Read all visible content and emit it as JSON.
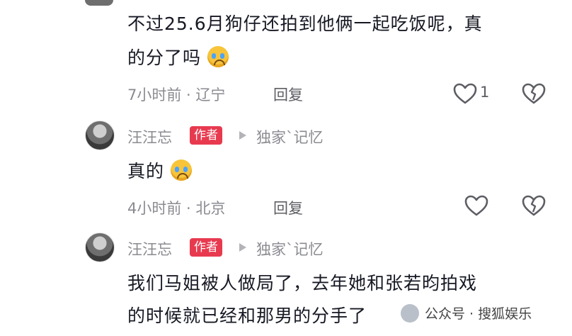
{
  "comments": [
    {
      "text_line1": "不过25.6月狗仔还拍到他俩一起吃饭呢，真",
      "text_line2": "的分了吗",
      "emoji": "crying-face-emoji",
      "time_location": "7小时前 · 辽宁",
      "reply_label": "回复",
      "like_count": "1"
    },
    {
      "username": "汪汪忘",
      "author_badge": "作者",
      "reply_to": "独家`记忆",
      "text": "真的",
      "emoji": "crying-face-emoji",
      "time_location": "4小时前 · 北京",
      "reply_label": "回复"
    },
    {
      "username": "汪汪忘",
      "author_badge": "作者",
      "reply_to": "独家`记忆",
      "text_line1": "我们马姐被人做局了，去年她和张若昀拍戏",
      "text_line2": "的时候就已经和那男的分手了"
    }
  ],
  "watermark": {
    "text": "公众号 · 搜狐娱乐"
  },
  "colors": {
    "badge": "#e83a4f",
    "meta": "#8a8b91",
    "text": "#161823"
  }
}
